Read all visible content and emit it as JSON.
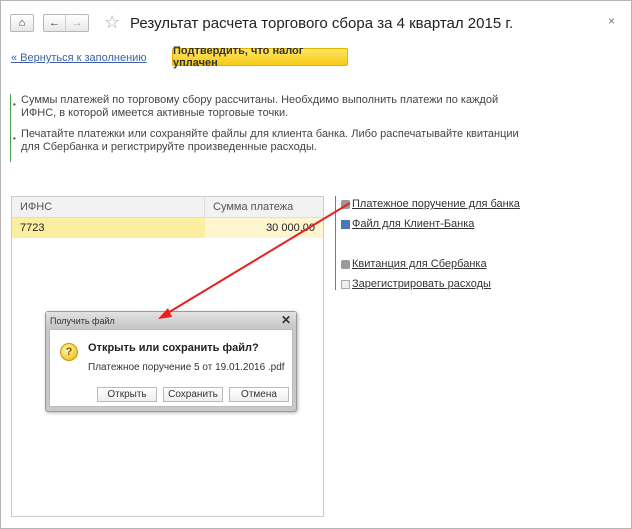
{
  "header": {
    "title": "Результат расчета торгового сбора за 4 квартал 2015 г.",
    "close": "×",
    "star": "☆",
    "home": "⌂",
    "back": "←",
    "forward": "→"
  },
  "toolbar": {
    "back_link": "« Вернуться к заполнению",
    "confirm_button": "Подтвердить, что налог уплачен"
  },
  "info": [
    "Суммы платежей по торговому сбору рассчитаны. Необхдимо выполнить платежи по каждой ИФНС, в которой имеется активные торговые точки.",
    "Печатайте платежки или сохраняйте файлы для клиента банка. Либо распечатывайте квитанции для Сбербанка и регистрируйте произведенные расходы."
  ],
  "table": {
    "columns": [
      "ИФНС",
      "Сумма платежа"
    ],
    "rows": [
      [
        "7723",
        "30 000,00"
      ]
    ]
  },
  "actions": [
    "Платежное поручение для банка",
    "Файл для Клиент-Банка",
    "Квитанция для Сбербанка",
    "Зарегистрировать расходы"
  ],
  "dialog": {
    "title": "Получить файл",
    "close": "✕",
    "heading": "Открыть или сохранить файл?",
    "file": "Платежное поручение 5 от 19.01.2016 .pdf",
    "buttons": [
      "Открыть",
      "Сохранить",
      "Отмена"
    ],
    "icon": "?"
  },
  "colors": {
    "accent": "#f6c915",
    "green": "#3ca34a",
    "arrow": "#e82020"
  }
}
